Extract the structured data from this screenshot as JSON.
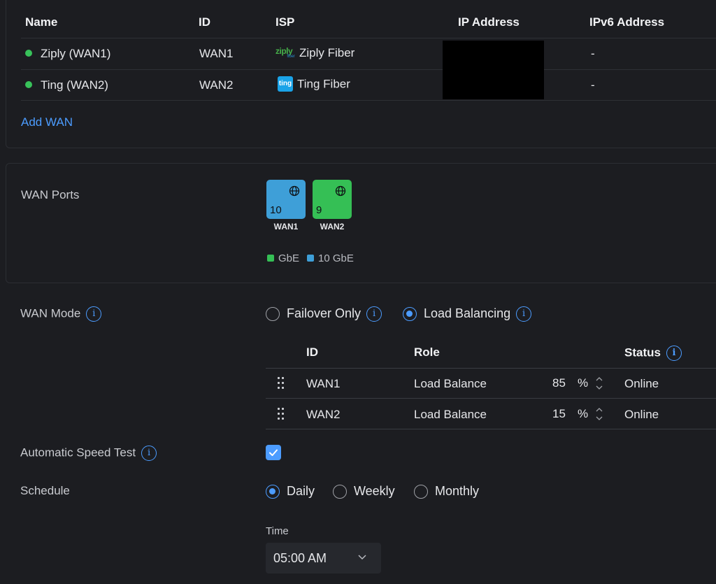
{
  "wan_table": {
    "headers": {
      "name": "Name",
      "id": "ID",
      "isp": "ISP",
      "ip": "IP Address",
      "ipv6": "IPv6 Address"
    },
    "rows": [
      {
        "name": "Ziply (WAN1)",
        "id": "WAN1",
        "isp": "Ziply Fiber",
        "isp_logo": "ziply-logo",
        "isp_logo_text": "ziply",
        "isp_logo_sub": "fiber",
        "ip": "",
        "ipv6": "-",
        "status_color": "#38c25a"
      },
      {
        "name": "Ting (WAN2)",
        "id": "WAN2",
        "isp": "Ting Fiber",
        "isp_logo": "ting-logo",
        "isp_logo_text": "ting",
        "ip": "",
        "ipv6": "-",
        "status_color": "#38c25a"
      }
    ],
    "add_link": "Add WAN"
  },
  "wan_ports": {
    "label": "WAN Ports",
    "ports": [
      {
        "number": "10",
        "name": "WAN1",
        "color": "#3e9fd8",
        "icon": "globe-icon"
      },
      {
        "number": "9",
        "name": "WAN2",
        "color": "#35bf55",
        "icon": "globe-icon"
      }
    ],
    "legend": [
      {
        "label": "GbE",
        "color": "#35bf55"
      },
      {
        "label": "10 GbE",
        "color": "#3e9fd8"
      }
    ]
  },
  "wan_mode": {
    "label": "WAN Mode",
    "options": [
      {
        "label": "Failover Only",
        "selected": false
      },
      {
        "label": "Load Balancing",
        "selected": true
      }
    ],
    "table": {
      "headers": {
        "id": "ID",
        "role": "Role",
        "status": "Status"
      },
      "rows": [
        {
          "id": "WAN1",
          "role": "Load Balance",
          "weight": "85",
          "unit": "%",
          "status": "Online"
        },
        {
          "id": "WAN2",
          "role": "Load Balance",
          "weight": "15",
          "unit": "%",
          "status": "Online"
        }
      ]
    }
  },
  "speed_test": {
    "label": "Automatic Speed Test",
    "checked": true
  },
  "schedule": {
    "label": "Schedule",
    "options": [
      {
        "label": "Daily",
        "selected": true
      },
      {
        "label": "Weekly",
        "selected": false
      },
      {
        "label": "Monthly",
        "selected": false
      }
    ],
    "time_label": "Time",
    "time_value": "05:00 AM"
  },
  "colors": {
    "accent": "#4c9cff",
    "online": "#38c25a",
    "background": "#1c1d21"
  }
}
